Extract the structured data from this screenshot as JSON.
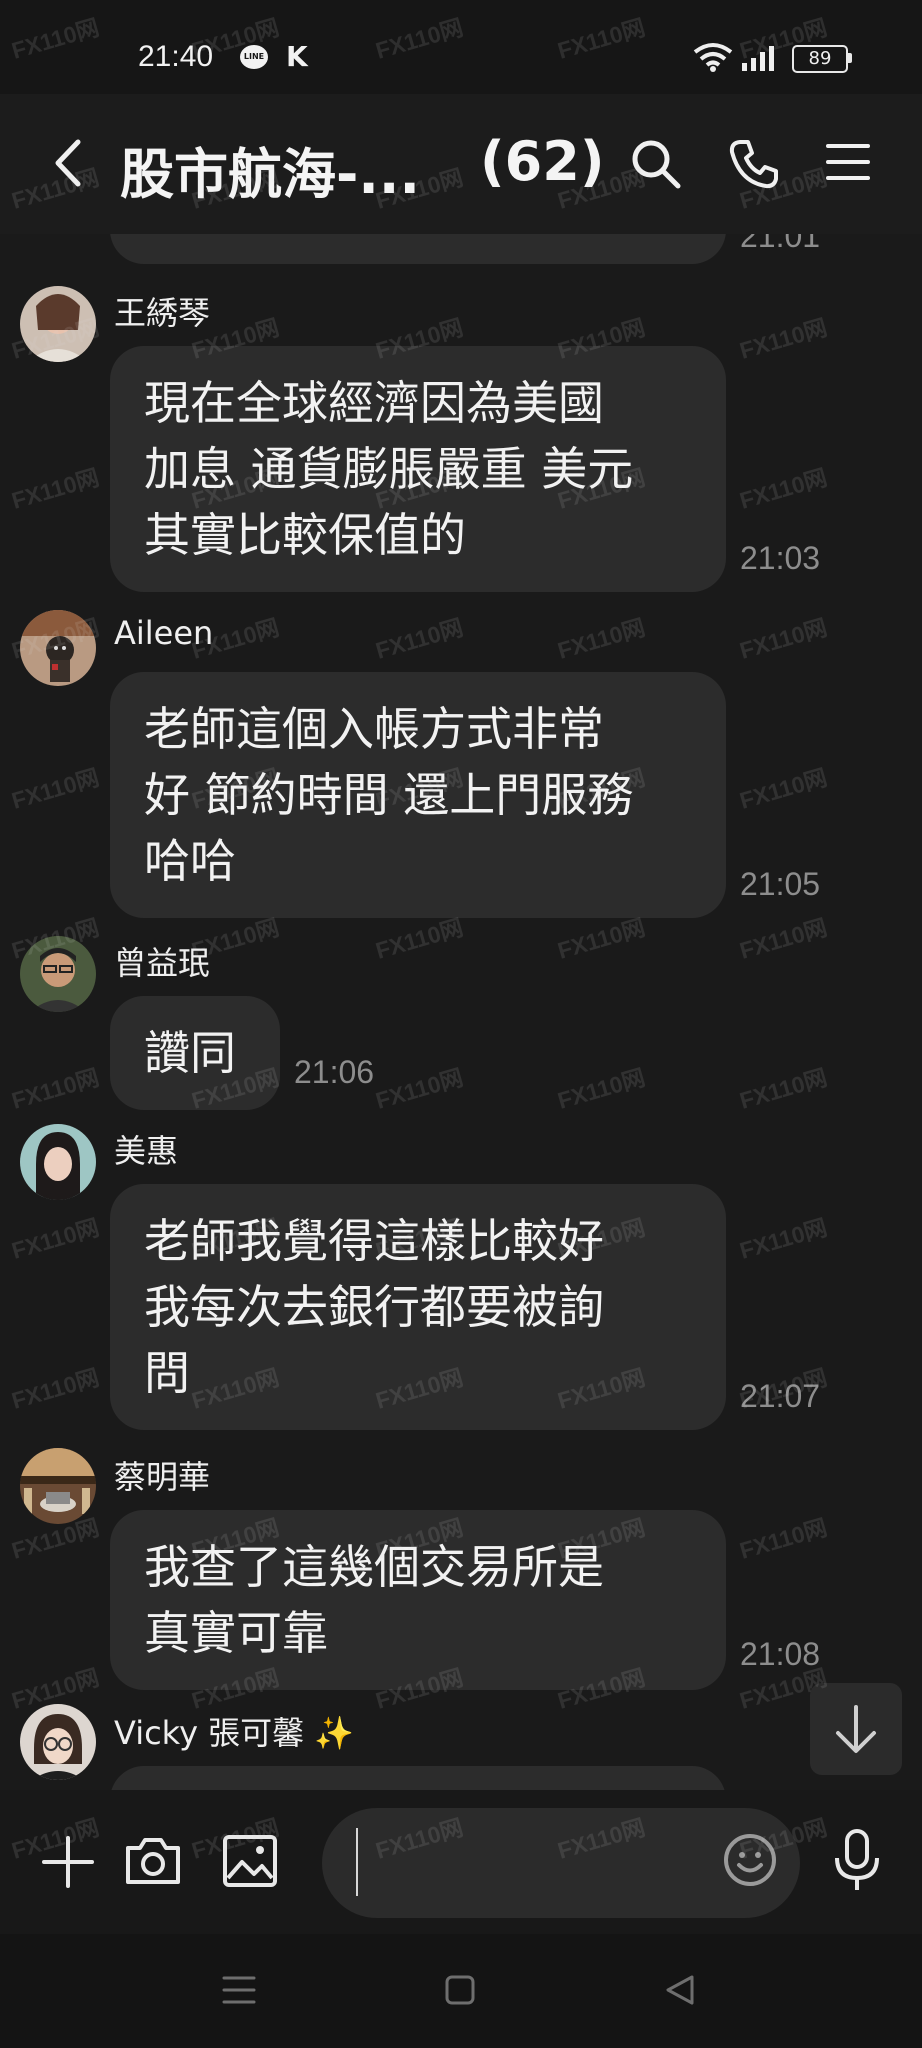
{
  "status_bar": {
    "time": "21:40",
    "line_badge": "LINE",
    "k_badge": "K",
    "battery": "89"
  },
  "header": {
    "title": "股市航海-...",
    "member_count": "(62)"
  },
  "chat": {
    "partial_top_time": "21:01",
    "messages": [
      {
        "sender": "王綉琴",
        "text": "現在全球經濟因為美國\n加息 通貨膨脹嚴重 美元\n其實比較保值的",
        "time": "21:03"
      },
      {
        "sender": "Aileen",
        "text": "老師這個入帳方式非常\n好 節約時間 還上門服務\n哈哈",
        "time": "21:05"
      },
      {
        "sender": "曾益珉",
        "text": "讚同",
        "time": "21:06"
      },
      {
        "sender": "美惠",
        "text": "老師我覺得這樣比較好\n我每次去銀行都要被詢\n問",
        "time": "21:07"
      },
      {
        "sender": "蔡明華",
        "text": "我查了這幾個交易所是\n真實可靠",
        "time": "21:08"
      },
      {
        "sender": "Vicky 張可馨 ✨"
      }
    ]
  },
  "composer": {
    "placeholder": ""
  },
  "watermark": "FX110网",
  "colors": {
    "background": "#1a1a1a",
    "bubble": "#2c2c2c",
    "timestamp": "#8d8d8d"
  },
  "icons": [
    "back-icon",
    "search-icon",
    "phone-icon",
    "menu-icon",
    "plus-icon",
    "camera-icon",
    "image-icon",
    "emoji-icon",
    "mic-icon",
    "arrow-down-icon"
  ]
}
